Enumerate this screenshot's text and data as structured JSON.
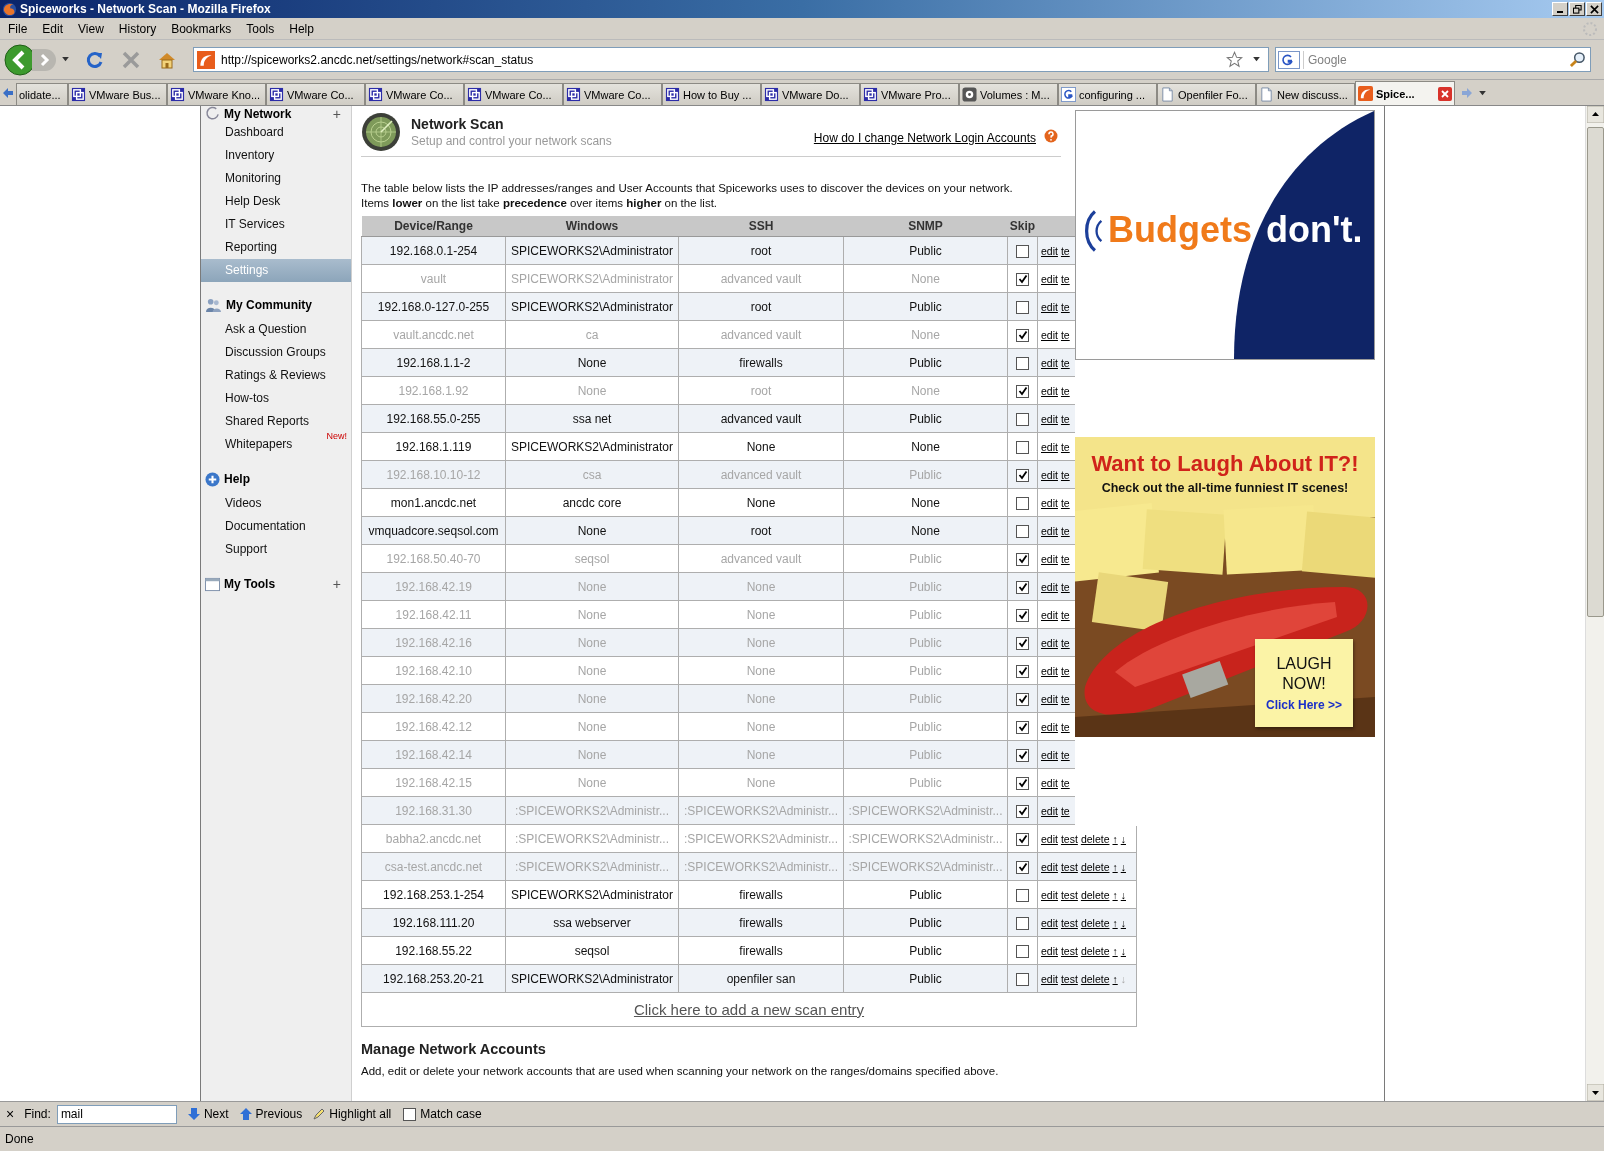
{
  "window": {
    "title": "Spiceworks - Network Scan - Mozilla Firefox"
  },
  "menu": [
    "File",
    "Edit",
    "View",
    "History",
    "Bookmarks",
    "Tools",
    "Help"
  ],
  "address_bar": {
    "url": "http://spiceworks2.ancdc.net/settings/network#scan_status"
  },
  "search_box": {
    "placeholder": "Google"
  },
  "tabs": [
    {
      "label": "olidate...",
      "kind": "plain",
      "selected": false
    },
    {
      "label": "VMware Bus...",
      "kind": "vmware",
      "selected": false
    },
    {
      "label": "VMware Kno...",
      "kind": "vmware",
      "selected": false
    },
    {
      "label": "VMware Co...",
      "kind": "vmware",
      "selected": false
    },
    {
      "label": "VMware Co...",
      "kind": "vmware",
      "selected": false
    },
    {
      "label": "VMware Co...",
      "kind": "vmware",
      "selected": false
    },
    {
      "label": "VMware Co...",
      "kind": "vmware",
      "selected": false
    },
    {
      "label": "How to Buy ...",
      "kind": "vmware",
      "selected": false
    },
    {
      "label": "VMware Do...",
      "kind": "vmware",
      "selected": false
    },
    {
      "label": "VMware Pro...",
      "kind": "vmware",
      "selected": false
    },
    {
      "label": "Volumes : M...",
      "kind": "disk",
      "selected": false
    },
    {
      "label": "configuring ...",
      "kind": "google",
      "selected": false
    },
    {
      "label": "Openfiler Fo...",
      "kind": "page",
      "selected": false
    },
    {
      "label": "New discuss...",
      "kind": "page",
      "selected": false
    },
    {
      "label": "Spice...",
      "kind": "spiceworks",
      "selected": true
    }
  ],
  "sidebar": {
    "sections": [
      {
        "title": "My Network",
        "kind": "network",
        "add": "+",
        "items": [
          {
            "label": "Dashboard",
            "selected": false
          },
          {
            "label": "Inventory",
            "selected": false
          },
          {
            "label": "Monitoring",
            "selected": false
          },
          {
            "label": "Help Desk",
            "selected": false
          },
          {
            "label": "IT Services",
            "selected": false
          },
          {
            "label": "Reporting",
            "selected": false
          },
          {
            "label": "Settings",
            "selected": true
          }
        ]
      },
      {
        "title": "My Community",
        "kind": "community",
        "items": [
          {
            "label": "Ask a Question",
            "selected": false
          },
          {
            "label": "Discussion Groups",
            "selected": false
          },
          {
            "label": "Ratings & Reviews",
            "selected": false
          },
          {
            "label": "How-tos",
            "selected": false
          },
          {
            "label": "Shared Reports",
            "selected": false
          },
          {
            "label": "Whitepapers",
            "selected": false,
            "badge": "New!"
          }
        ]
      },
      {
        "title": "Help",
        "kind": "help",
        "items": [
          {
            "label": "Videos",
            "selected": false
          },
          {
            "label": "Documentation",
            "selected": false
          },
          {
            "label": "Support",
            "selected": false
          }
        ]
      },
      {
        "title": "My Tools",
        "kind": "tools",
        "add": "+"
      }
    ]
  },
  "page": {
    "title": "Network Scan",
    "subtitle": "Setup and control your network scans",
    "help_link": "How do I change Network Login Accounts",
    "description": [
      "The table below lists the IP addresses/ranges and User Accounts that Spiceworks uses to discover the devices on your network.",
      "Items **lower** on the list take **precedence** over items **higher** on the list."
    ]
  },
  "table": {
    "columns": [
      "Device/Range",
      "Windows",
      "SSH",
      "SNMP",
      "Skip"
    ],
    "rows": [
      {
        "device": "192.168.0.1-254",
        "windows": "SPICEWORKS2\\Administrator",
        "ssh": "root",
        "snmp": "Public",
        "skip": false,
        "actions": [
          {
            "label": "edit",
            "disabled": false
          },
          {
            "label": "te",
            "disabled": false
          }
        ]
      },
      {
        "device": "vault",
        "windows": "SPICEWORKS2\\Administrator",
        "ssh": "advanced vault",
        "snmp": "None",
        "skip": true,
        "actions": [
          {
            "label": "edit",
            "disabled": false
          },
          {
            "label": "te",
            "disabled": false
          }
        ]
      },
      {
        "device": "192.168.0-127.0-255",
        "windows": "SPICEWORKS2\\Administrator",
        "ssh": "root",
        "snmp": "Public",
        "skip": false,
        "actions": [
          {
            "label": "edit",
            "disabled": false
          },
          {
            "label": "te",
            "disabled": false
          }
        ]
      },
      {
        "device": "vault.ancdc.net",
        "windows": "ca",
        "ssh": "advanced vault",
        "snmp": "None",
        "skip": true,
        "actions": [
          {
            "label": "edit",
            "disabled": false
          },
          {
            "label": "te",
            "disabled": false
          }
        ]
      },
      {
        "device": "192.168.1.1-2",
        "windows": "None",
        "ssh": "firewalls",
        "snmp": "Public",
        "skip": false,
        "actions": [
          {
            "label": "edit",
            "disabled": false
          },
          {
            "label": "te",
            "disabled": false
          }
        ]
      },
      {
        "device": "192.168.1.92",
        "windows": "None",
        "ssh": "root",
        "snmp": "None",
        "skip": true,
        "actions": [
          {
            "label": "edit",
            "disabled": false
          },
          {
            "label": "te",
            "disabled": false
          }
        ]
      },
      {
        "device": "192.168.55.0-255",
        "windows": "ssa net",
        "ssh": "advanced vault",
        "snmp": "Public",
        "skip": false,
        "actions": [
          {
            "label": "edit",
            "disabled": false
          },
          {
            "label": "te",
            "disabled": false
          }
        ]
      },
      {
        "device": "192.168.1.119",
        "windows": "SPICEWORKS2\\Administrator",
        "ssh": "None",
        "snmp": "None",
        "skip": false,
        "actions": [
          {
            "label": "edit",
            "disabled": false
          },
          {
            "label": "te",
            "disabled": false
          }
        ]
      },
      {
        "device": "192.168.10.10-12",
        "windows": "csa",
        "ssh": "advanced vault",
        "snmp": "Public",
        "skip": true,
        "actions": [
          {
            "label": "edit",
            "disabled": false
          },
          {
            "label": "te",
            "disabled": false
          }
        ]
      },
      {
        "device": "mon1.ancdc.net",
        "windows": "ancdc core",
        "ssh": "None",
        "snmp": "None",
        "skip": false,
        "actions": [
          {
            "label": "edit",
            "disabled": false
          },
          {
            "label": "te",
            "disabled": false
          }
        ]
      },
      {
        "device": "vmquadcore.seqsol.com",
        "windows": "None",
        "ssh": "root",
        "snmp": "None",
        "skip": false,
        "actions": [
          {
            "label": "edit",
            "disabled": false
          },
          {
            "label": "te",
            "disabled": false
          }
        ]
      },
      {
        "device": "192.168.50.40-70",
        "windows": "seqsol",
        "ssh": "advanced vault",
        "snmp": "Public",
        "skip": true,
        "actions": [
          {
            "label": "edit",
            "disabled": false
          },
          {
            "label": "te",
            "disabled": false
          }
        ]
      },
      {
        "device": "192.168.42.19",
        "windows": "None",
        "ssh": "None",
        "snmp": "Public",
        "skip": true,
        "actions": [
          {
            "label": "edit",
            "disabled": false
          },
          {
            "label": "te",
            "disabled": false
          }
        ]
      },
      {
        "device": "192.168.42.11",
        "windows": "None",
        "ssh": "None",
        "snmp": "Public",
        "skip": true,
        "actions": [
          {
            "label": "edit",
            "disabled": false
          },
          {
            "label": "te",
            "disabled": false
          }
        ]
      },
      {
        "device": "192.168.42.16",
        "windows": "None",
        "ssh": "None",
        "snmp": "Public",
        "skip": true,
        "actions": [
          {
            "label": "edit",
            "disabled": false
          },
          {
            "label": "te",
            "disabled": false
          }
        ]
      },
      {
        "device": "192.168.42.10",
        "windows": "None",
        "ssh": "None",
        "snmp": "Public",
        "skip": true,
        "actions": [
          {
            "label": "edit",
            "disabled": false
          },
          {
            "label": "te",
            "disabled": false
          }
        ]
      },
      {
        "device": "192.168.42.20",
        "windows": "None",
        "ssh": "None",
        "snmp": "Public",
        "skip": true,
        "actions": [
          {
            "label": "edit",
            "disabled": false
          },
          {
            "label": "te",
            "disabled": false
          }
        ]
      },
      {
        "device": "192.168.42.12",
        "windows": "None",
        "ssh": "None",
        "snmp": "Public",
        "skip": true,
        "actions": [
          {
            "label": "edit",
            "disabled": false
          },
          {
            "label": "te",
            "disabled": false
          }
        ]
      },
      {
        "device": "192.168.42.14",
        "windows": "None",
        "ssh": "None",
        "snmp": "Public",
        "skip": true,
        "actions": [
          {
            "label": "edit",
            "disabled": false
          },
          {
            "label": "te",
            "disabled": false
          }
        ]
      },
      {
        "device": "192.168.42.15",
        "windows": "None",
        "ssh": "None",
        "snmp": "Public",
        "skip": true,
        "actions": [
          {
            "label": "edit",
            "disabled": false
          },
          {
            "label": "te",
            "disabled": false
          }
        ]
      },
      {
        "device": "192.168.31.30",
        "windows": ":SPICEWORKS2\\Administr...",
        "ssh": ":SPICEWORKS2\\Administr...",
        "snmp": ":SPICEWORKS2\\Administr...",
        "skip": true,
        "actions": [
          {
            "label": "edit",
            "disabled": false
          },
          {
            "label": "te",
            "disabled": false
          }
        ]
      },
      {
        "device": "babha2.ancdc.net",
        "windows": ":SPICEWORKS2\\Administr...",
        "ssh": ":SPICEWORKS2\\Administr...",
        "snmp": ":SPICEWORKS2\\Administr...",
        "skip": true,
        "actions": [
          {
            "label": "edit",
            "disabled": false
          },
          {
            "label": "test",
            "disabled": false
          },
          {
            "label": "delete",
            "disabled": false
          },
          {
            "label": "↑",
            "disabled": false
          },
          {
            "label": "↓",
            "disabled": false
          }
        ]
      },
      {
        "device": "csa-test.ancdc.net",
        "windows": ":SPICEWORKS2\\Administr...",
        "ssh": ":SPICEWORKS2\\Administr...",
        "snmp": ":SPICEWORKS2\\Administr...",
        "skip": true,
        "actions": [
          {
            "label": "edit",
            "disabled": false
          },
          {
            "label": "test",
            "disabled": false
          },
          {
            "label": "delete",
            "disabled": false
          },
          {
            "label": "↑",
            "disabled": false
          },
          {
            "label": "↓",
            "disabled": false
          }
        ]
      },
      {
        "device": "192.168.253.1-254",
        "windows": "SPICEWORKS2\\Administrator",
        "ssh": "firewalls",
        "snmp": "Public",
        "skip": false,
        "actions": [
          {
            "label": "edit",
            "disabled": false
          },
          {
            "label": "test",
            "disabled": false
          },
          {
            "label": "delete",
            "disabled": false
          },
          {
            "label": "↑",
            "disabled": false
          },
          {
            "label": "↓",
            "disabled": false
          }
        ]
      },
      {
        "device": "192.168.111.20",
        "windows": "ssa webserver",
        "ssh": "firewalls",
        "snmp": "Public",
        "skip": false,
        "actions": [
          {
            "label": "edit",
            "disabled": false
          },
          {
            "label": "test",
            "disabled": false
          },
          {
            "label": "delete",
            "disabled": false
          },
          {
            "label": "↑",
            "disabled": false
          },
          {
            "label": "↓",
            "disabled": false
          }
        ]
      },
      {
        "device": "192.168.55.22",
        "windows": "seqsol",
        "ssh": "firewalls",
        "snmp": "Public",
        "skip": false,
        "actions": [
          {
            "label": "edit",
            "disabled": false
          },
          {
            "label": "test",
            "disabled": false
          },
          {
            "label": "delete",
            "disabled": false
          },
          {
            "label": "↑",
            "disabled": false
          },
          {
            "label": "↓",
            "disabled": false
          }
        ]
      },
      {
        "device": "192.168.253.20-21",
        "windows": "SPICEWORKS2\\Administrator",
        "ssh": "openfiler san",
        "snmp": "Public",
        "skip": false,
        "actions": [
          {
            "label": "edit",
            "disabled": false
          },
          {
            "label": "test",
            "disabled": false
          },
          {
            "label": "delete",
            "disabled": false
          },
          {
            "label": "↑",
            "disabled": false
          },
          {
            "label": "↓",
            "disabled": true
          }
        ]
      }
    ],
    "add_link": "Click here to add a new scan entry"
  },
  "accounts": {
    "title": "Manage Network Accounts",
    "description": "Add, edit or delete your network accounts that are used when scanning your network on the ranges/domains specified above."
  },
  "ads": [
    {
      "kind": "budget",
      "headline": "Budgets",
      "tagline": "don't."
    },
    {
      "kind": "laugh",
      "headline": "Want to Laugh About IT?!",
      "subline": "Check out the all-time funniest IT scenes!",
      "note": "LAUGH NOW!",
      "cta": "Click Here >>"
    }
  ],
  "find_bar": {
    "close": "×",
    "label": "Find:",
    "value": "mail",
    "buttons": [
      "Next",
      "Previous",
      "Highlight all"
    ],
    "match_case": {
      "label": "Match case",
      "checked": false
    }
  },
  "status_bar": "Done"
}
